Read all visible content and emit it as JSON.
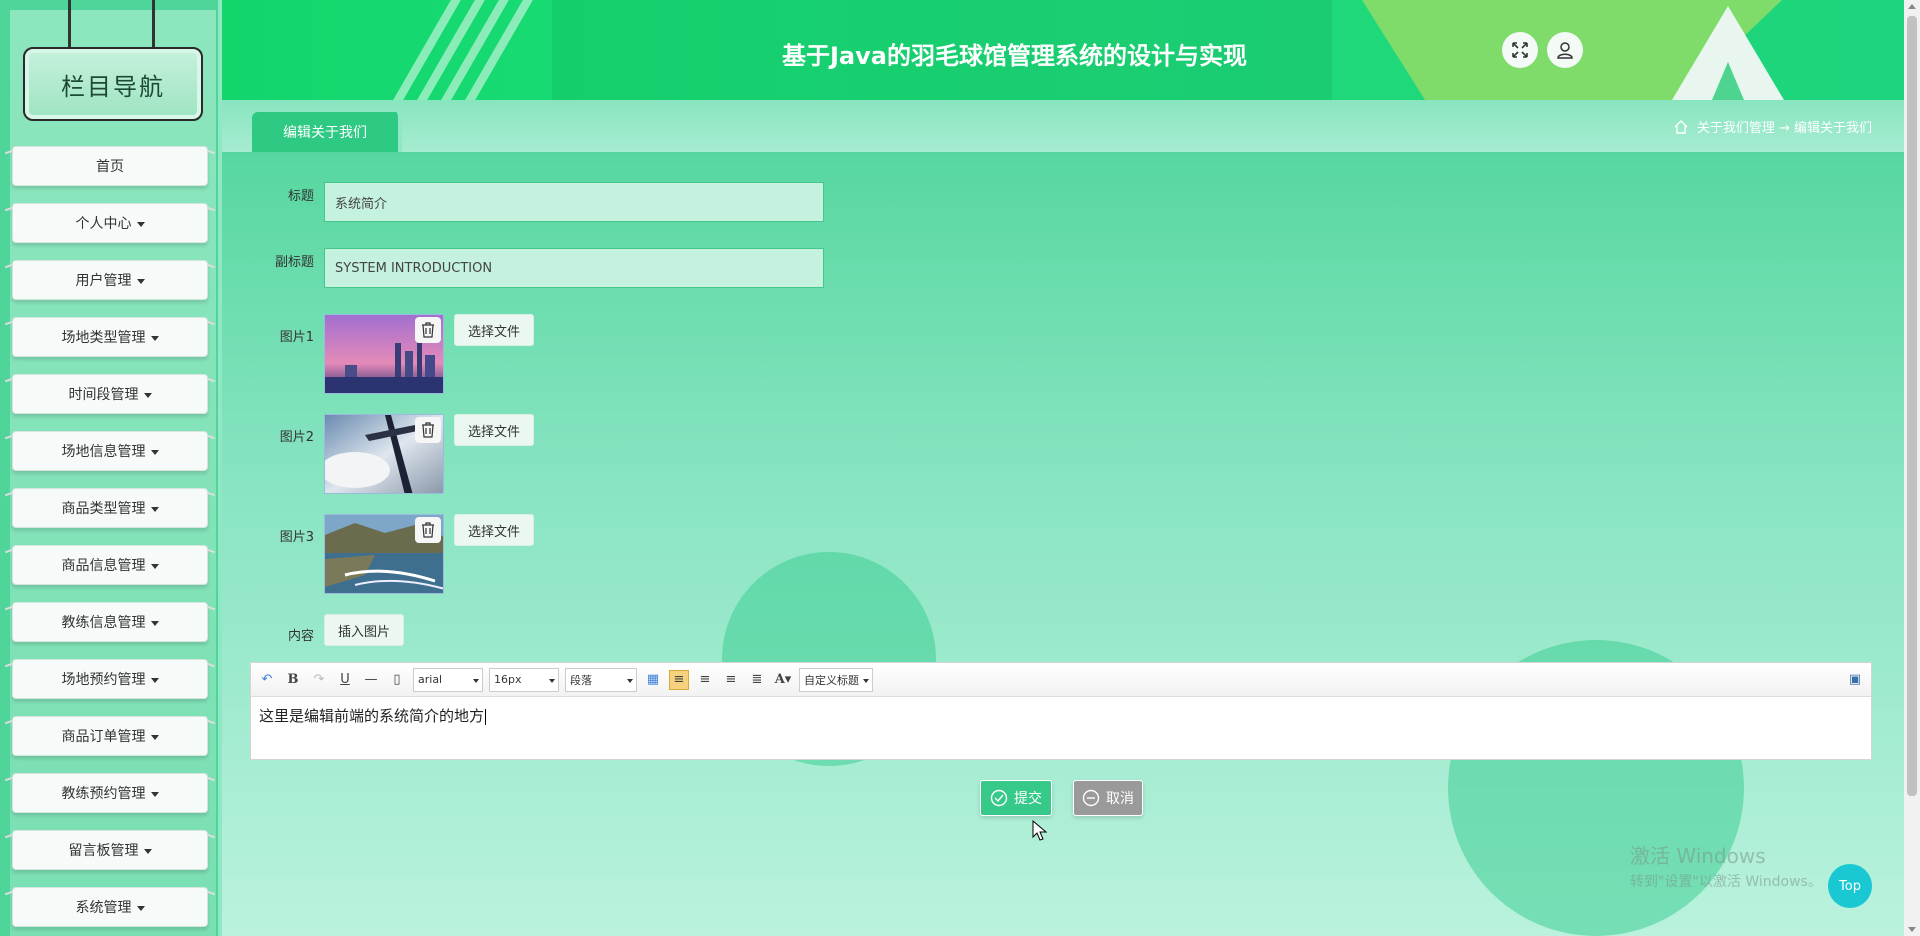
{
  "sidebar": {
    "title": "栏目导航",
    "items": [
      {
        "label": "首页",
        "dropdown": false
      },
      {
        "label": "个人中心",
        "dropdown": true
      },
      {
        "label": "用户管理",
        "dropdown": true
      },
      {
        "label": "场地类型管理",
        "dropdown": true
      },
      {
        "label": "时间段管理",
        "dropdown": true
      },
      {
        "label": "场地信息管理",
        "dropdown": true
      },
      {
        "label": "商品类型管理",
        "dropdown": true
      },
      {
        "label": "商品信息管理",
        "dropdown": true
      },
      {
        "label": "教练信息管理",
        "dropdown": true
      },
      {
        "label": "场地预约管理",
        "dropdown": true
      },
      {
        "label": "商品订单管理",
        "dropdown": true
      },
      {
        "label": "教练预约管理",
        "dropdown": true
      },
      {
        "label": "留言板管理",
        "dropdown": true
      },
      {
        "label": "系统管理",
        "dropdown": true
      }
    ]
  },
  "header": {
    "title": "基于Java的羽毛球馆管理系统的设计与实现",
    "fullscreen_icon": "expand-icon",
    "user_icon": "user-icon"
  },
  "tabs": {
    "active": "编辑关于我们"
  },
  "breadcrumb": {
    "home_icon": "home-icon",
    "text": "关于我们管理 → 编辑关于我们"
  },
  "form": {
    "title_label": "标题",
    "title_value": "系统简介",
    "subtitle_label": "副标题",
    "subtitle_value": "SYSTEM INTRODUCTION",
    "images": [
      {
        "label": "图片1",
        "button": "选择文件"
      },
      {
        "label": "图片2",
        "button": "选择文件"
      },
      {
        "label": "图片3",
        "button": "选择文件"
      }
    ],
    "content_label": "内容",
    "insert_image_button": "插入图片"
  },
  "editor": {
    "font_family": "arial",
    "font_size": "16px",
    "paragraph": "段落",
    "custom_title": "自定义标题",
    "body_text": "这里是编辑前端的系统简介的地方"
  },
  "actions": {
    "submit": "提交",
    "cancel": "取消"
  },
  "watermark": {
    "line1": "激活 Windows",
    "line2": "转到\"设置\"以激活 Windows。"
  },
  "top_button": "Top",
  "colors": {
    "accent": "#2ec983",
    "header": "#1adc77",
    "submit": "#37c98a",
    "cancel": "#9a9a9a",
    "top": "#19c8d2"
  }
}
